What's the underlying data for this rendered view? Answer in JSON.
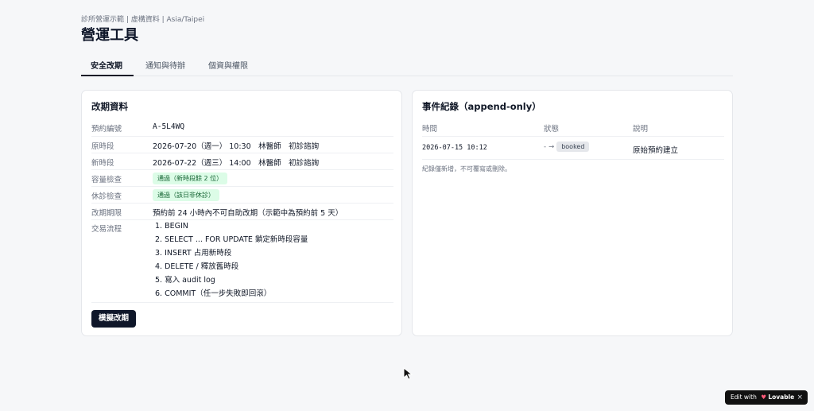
{
  "header": {
    "meta": "診所營運示範 | 虛構資料 | Asia/Taipei",
    "title": "營運工具"
  },
  "tabs": [
    {
      "label": "安全改期",
      "active": true
    },
    {
      "label": "通知與待辦",
      "active": false
    },
    {
      "label": "個資與權限",
      "active": false
    }
  ],
  "reschedule": {
    "title": "改期資料",
    "rows": [
      {
        "label": "預約編號",
        "value": "A-5L4WQ"
      },
      {
        "label": "原時段",
        "value": "2026-07-20（週一） 10:30　林醫師　初診諮詢"
      },
      {
        "label": "新時段",
        "value": "2026-07-22（週三） 14:00　林醫師　初診諮詢"
      },
      {
        "label": "容量檢查",
        "value": "通過（新時段餘 2 位）"
      },
      {
        "label": "休診檢查",
        "value": "通過（該日非休診）"
      },
      {
        "label": "改期期限",
        "value": "預約前 24 小時內不可自助改期（示範中為預約前 5 天）"
      },
      {
        "label": "交易流程"
      }
    ],
    "steps": [
      "1. BEGIN",
      "2. SELECT ... FOR UPDATE 鎖定新時段容量",
      "3. INSERT 占用新時段",
      "4. DELETE / 釋放舊時段",
      "5. 寫入 audit log",
      "6. COMMIT（任一步失敗即回滾）"
    ],
    "button_label": "模擬改期"
  },
  "events": {
    "title": "事件紀錄（append-only）",
    "columns": [
      "時間",
      "狀態",
      "說明"
    ],
    "rows": [
      {
        "time": "2026-07-15 10:12",
        "from": "-",
        "to": "booked",
        "desc": "原始預約建立"
      }
    ],
    "note": "紀錄僅新增，不可覆寫或刪除。"
  },
  "badge": {
    "prefix": "Edit with",
    "brand": "Lovable",
    "close": "×"
  },
  "colors": {
    "accent": "#0f172a",
    "success_bg": "#dcfce7",
    "success_fg": "#166534",
    "lovable_bg": "#111111"
  }
}
